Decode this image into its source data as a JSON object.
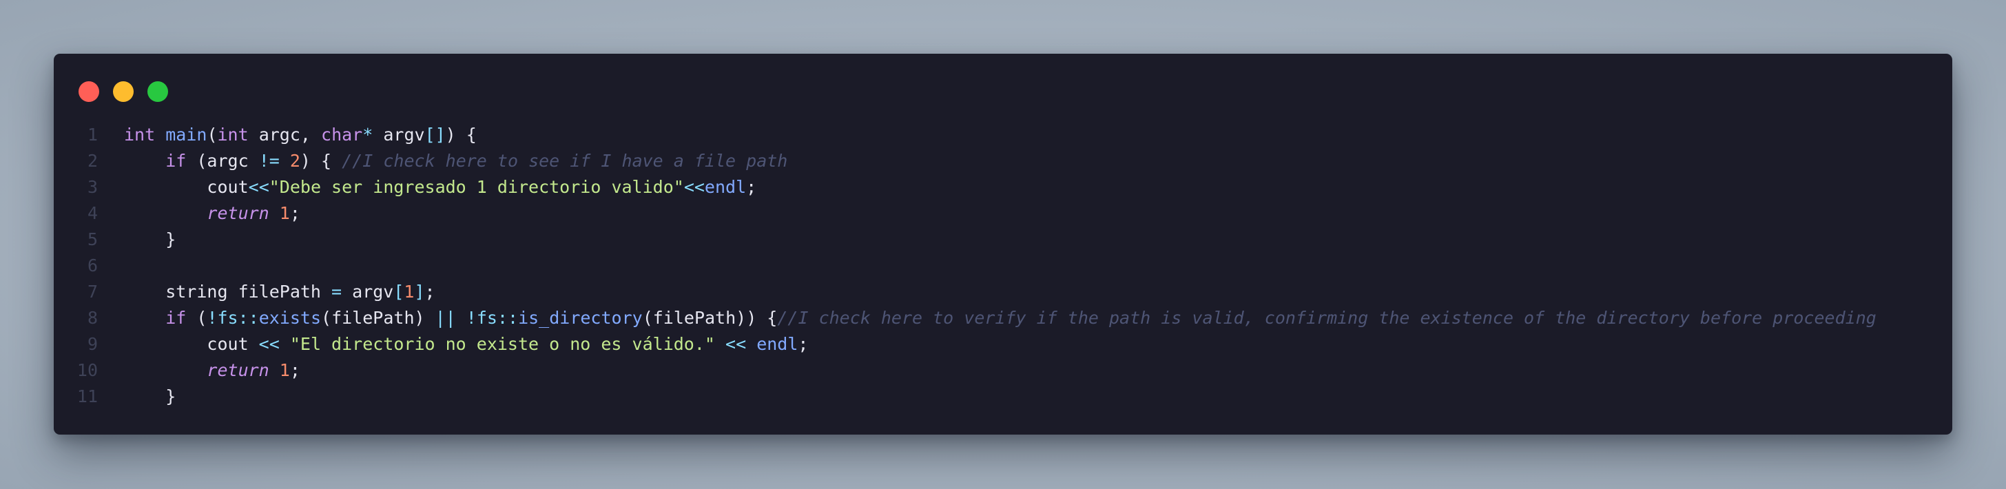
{
  "window": {
    "controls": [
      {
        "name": "close",
        "color": "#ff5f57"
      },
      {
        "name": "minimize",
        "color": "#febc2e"
      },
      {
        "name": "maximize",
        "color": "#28c840"
      }
    ]
  },
  "editor": {
    "language": "cpp",
    "line_numbers": [
      "1",
      "2",
      "3",
      "4",
      "5",
      "6",
      "7",
      "8",
      "9",
      "10",
      "11"
    ],
    "lines": [
      {
        "tokens": [
          {
            "t": "int",
            "c": "kw"
          },
          {
            "t": " ",
            "c": "pl"
          },
          {
            "t": "main",
            "c": "fn"
          },
          {
            "t": "(",
            "c": "pl"
          },
          {
            "t": "int",
            "c": "kw"
          },
          {
            "t": " argc, ",
            "c": "pl"
          },
          {
            "t": "char",
            "c": "kw"
          },
          {
            "t": "*",
            "c": "op"
          },
          {
            "t": " argv",
            "c": "pl"
          },
          {
            "t": "[]",
            "c": "op"
          },
          {
            "t": ") {",
            "c": "pl"
          }
        ]
      },
      {
        "tokens": [
          {
            "t": "    ",
            "c": "pl"
          },
          {
            "t": "if",
            "c": "kw"
          },
          {
            "t": " (argc ",
            "c": "pl"
          },
          {
            "t": "!=",
            "c": "op"
          },
          {
            "t": " ",
            "c": "pl"
          },
          {
            "t": "2",
            "c": "num"
          },
          {
            "t": ") { ",
            "c": "pl"
          },
          {
            "t": "//I check here to see if I have a file path",
            "c": "cmt"
          }
        ]
      },
      {
        "tokens": [
          {
            "t": "        ",
            "c": "pl"
          },
          {
            "t": "cout",
            "c": "pl"
          },
          {
            "t": "<<",
            "c": "op"
          },
          {
            "t": "\"Debe ser ingresado 1 directorio valido\"",
            "c": "str"
          },
          {
            "t": "<<",
            "c": "op"
          },
          {
            "t": "endl",
            "c": "fn"
          },
          {
            "t": ";",
            "c": "pl"
          }
        ]
      },
      {
        "tokens": [
          {
            "t": "        ",
            "c": "pl"
          },
          {
            "t": "return",
            "c": "ret"
          },
          {
            "t": " ",
            "c": "pl"
          },
          {
            "t": "1",
            "c": "num"
          },
          {
            "t": ";",
            "c": "pl"
          }
        ]
      },
      {
        "tokens": [
          {
            "t": "    }",
            "c": "pl"
          }
        ]
      },
      {
        "tokens": []
      },
      {
        "tokens": [
          {
            "t": "    string filePath ",
            "c": "pl"
          },
          {
            "t": "=",
            "c": "op"
          },
          {
            "t": " argv",
            "c": "pl"
          },
          {
            "t": "[",
            "c": "op"
          },
          {
            "t": "1",
            "c": "num"
          },
          {
            "t": "]",
            "c": "op"
          },
          {
            "t": ";",
            "c": "pl"
          }
        ]
      },
      {
        "tokens": [
          {
            "t": "    ",
            "c": "pl"
          },
          {
            "t": "if",
            "c": "kw"
          },
          {
            "t": " (",
            "c": "pl"
          },
          {
            "t": "!",
            "c": "op"
          },
          {
            "t": "fs",
            "c": "ns"
          },
          {
            "t": "::",
            "c": "op"
          },
          {
            "t": "exists",
            "c": "fn"
          },
          {
            "t": "(filePath) ",
            "c": "pl"
          },
          {
            "t": "||",
            "c": "op"
          },
          {
            "t": " ",
            "c": "pl"
          },
          {
            "t": "!",
            "c": "op"
          },
          {
            "t": "fs",
            "c": "ns"
          },
          {
            "t": "::",
            "c": "op"
          },
          {
            "t": "is_directory",
            "c": "fn"
          },
          {
            "t": "(filePath)) {",
            "c": "pl"
          },
          {
            "t": "//I check here to verify if the path is valid, confirming the existence of the directory before proceeding",
            "c": "cmt"
          }
        ]
      },
      {
        "tokens": [
          {
            "t": "        cout ",
            "c": "pl"
          },
          {
            "t": "<<",
            "c": "op"
          },
          {
            "t": " ",
            "c": "pl"
          },
          {
            "t": "\"El directorio no existe o no es válido.\"",
            "c": "str"
          },
          {
            "t": " ",
            "c": "pl"
          },
          {
            "t": "<<",
            "c": "op"
          },
          {
            "t": " ",
            "c": "pl"
          },
          {
            "t": "endl",
            "c": "fn"
          },
          {
            "t": ";",
            "c": "pl"
          }
        ]
      },
      {
        "tokens": [
          {
            "t": "        ",
            "c": "pl"
          },
          {
            "t": "return",
            "c": "ret"
          },
          {
            "t": " ",
            "c": "pl"
          },
          {
            "t": "1",
            "c": "num"
          },
          {
            "t": ";",
            "c": "pl"
          }
        ]
      },
      {
        "tokens": [
          {
            "t": "    }",
            "c": "pl"
          }
        ]
      }
    ]
  }
}
